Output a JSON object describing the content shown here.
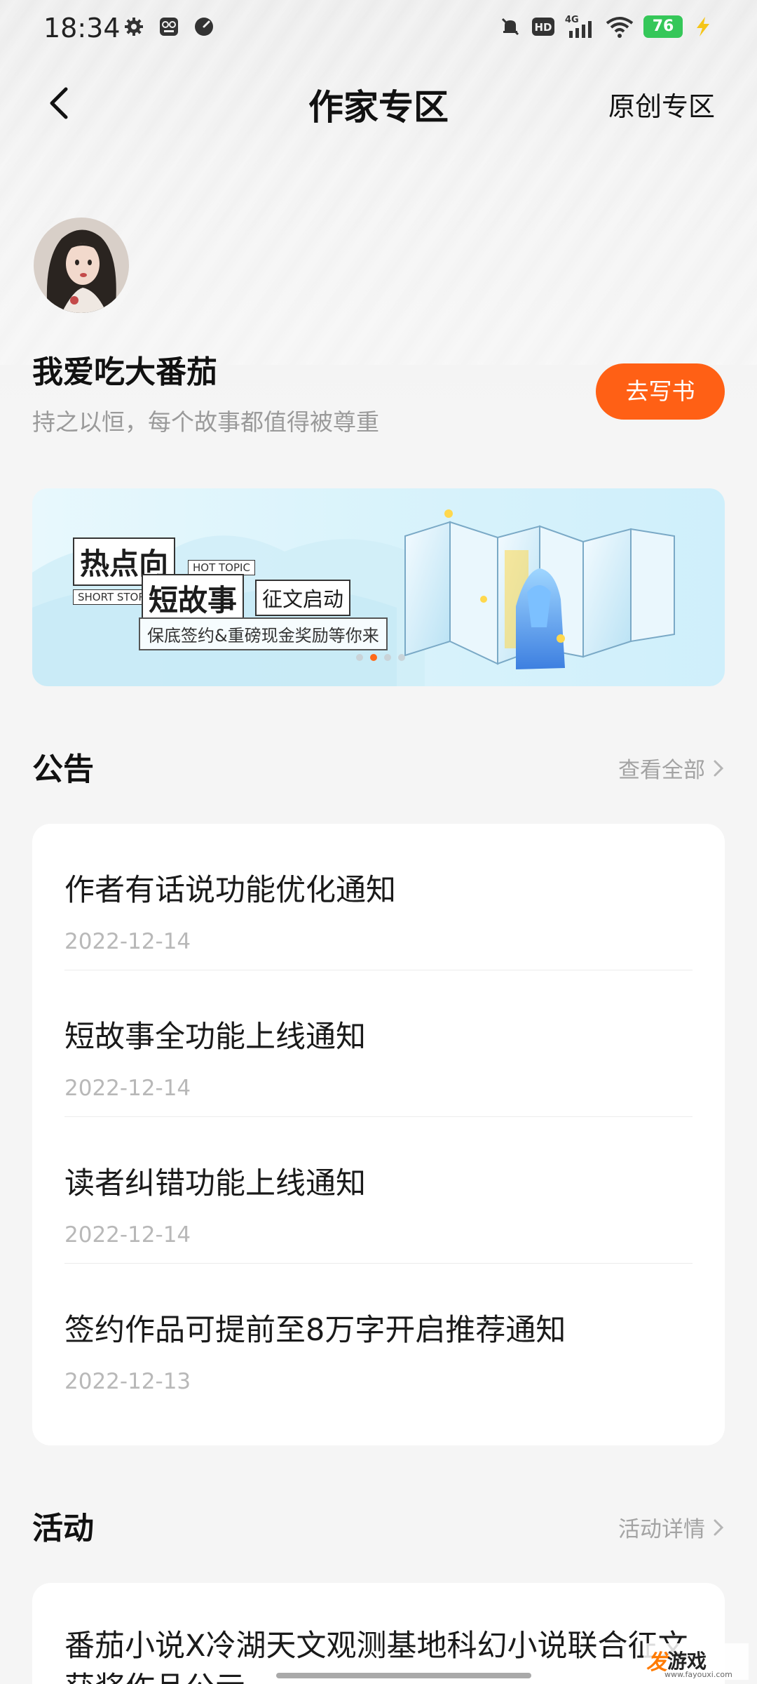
{
  "status_bar": {
    "time": "18:34",
    "battery": "76",
    "network": "4G",
    "hd": "HD"
  },
  "header": {
    "title": "作家专区",
    "right_link": "原创专区"
  },
  "profile": {
    "name": "我爱吃大番茄",
    "motto": "持之以恒，每个故事都值得被尊重",
    "write_button": "去写书"
  },
  "banner": {
    "line1": "热点向",
    "tag_hot": "HOT TOPIC",
    "tag_short": "SHORT STORY",
    "line2": "短故事",
    "line3": "征文启动",
    "subtitle": "保底签约&重磅现金奖励等你来",
    "active_slide": 2,
    "slide_count": 4
  },
  "notices": {
    "title": "公告",
    "more": "查看全部",
    "items": [
      {
        "title": "作者有话说功能优化通知",
        "date": "2022-12-14"
      },
      {
        "title": "短故事全功能上线通知",
        "date": "2022-12-14"
      },
      {
        "title": "读者纠错功能上线通知",
        "date": "2022-12-14"
      },
      {
        "title": "签约作品可提前至8万字开启推荐通知",
        "date": "2022-12-13"
      }
    ]
  },
  "activities": {
    "title": "活动",
    "more": "活动详情",
    "items": [
      {
        "title": "番茄小说X冷湖天文观测基地科幻小说联合征文获奖作品公示"
      }
    ]
  },
  "watermark": {
    "logo": "发",
    "text": "游戏",
    "url": "www.fayouxi.com"
  },
  "colors": {
    "accent": "#ff6015",
    "banner_bg": "#d9f3fb",
    "muted_text": "#9a9a9a"
  }
}
